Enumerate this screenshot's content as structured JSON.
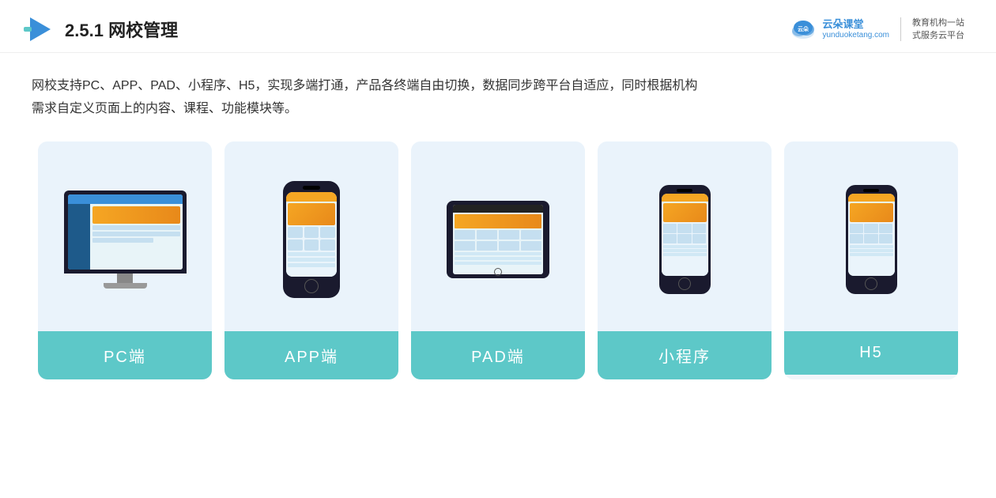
{
  "header": {
    "section_number": "2.5.1",
    "title_plain": "网校管理",
    "title_bold": "网校管理"
  },
  "brand": {
    "name": "云朵课堂",
    "domain": "yunduoketang.com",
    "slogan_line1": "教育机构一站",
    "slogan_line2": "式服务云平台"
  },
  "description": {
    "text_line1": "网校支持PC、APP、PAD、小程序、H5，实现多端打通，产品各终端自由切换，数据同步跨平台自适应，同时根据机构",
    "text_line2": "需求自定义页面上的内容、课程、功能模块等。"
  },
  "cards": [
    {
      "id": "pc",
      "label": "PC端",
      "device_type": "desktop"
    },
    {
      "id": "app",
      "label": "APP端",
      "device_type": "phone"
    },
    {
      "id": "pad",
      "label": "PAD端",
      "device_type": "tablet"
    },
    {
      "id": "miniapp",
      "label": "小程序",
      "device_type": "phone_small"
    },
    {
      "id": "h5",
      "label": "H5",
      "device_type": "phone_small"
    }
  ]
}
